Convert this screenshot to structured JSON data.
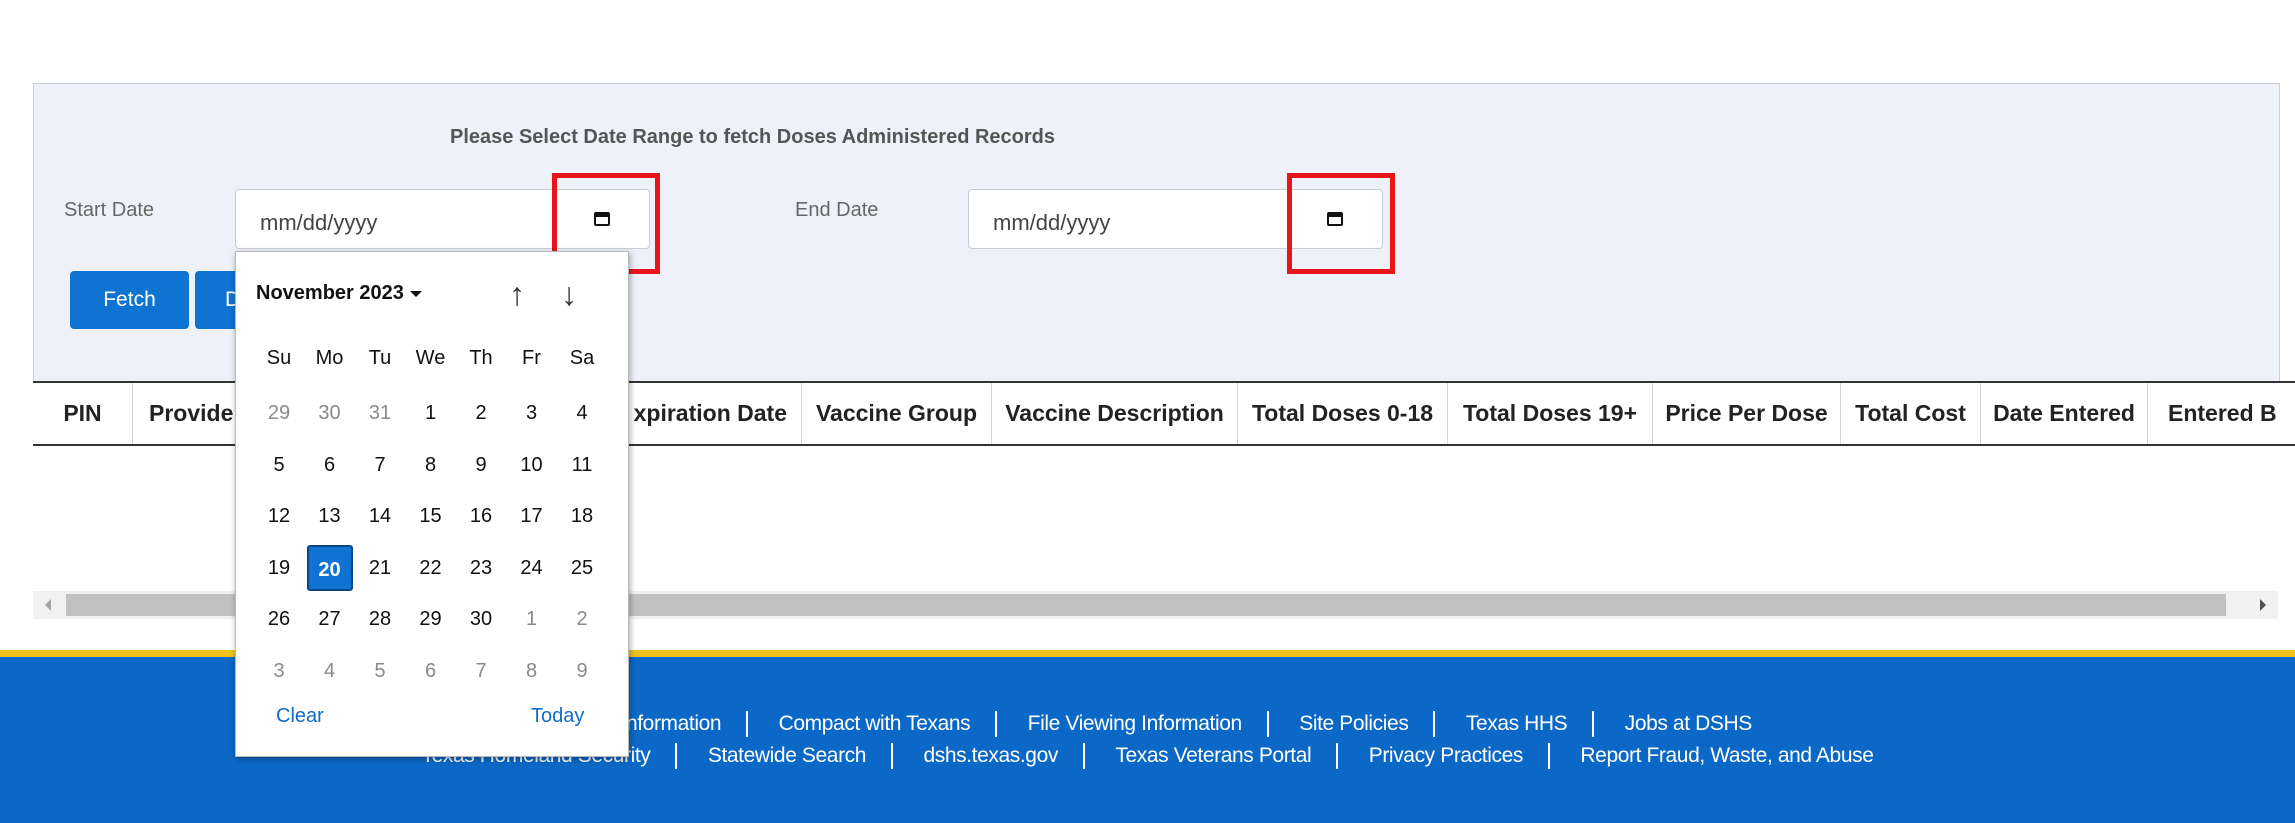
{
  "panel": {
    "heading": "Please Select Date Range to fetch Doses Administered Records",
    "start_label": "Start Date",
    "end_label": "End Date",
    "start_placeholder": "mm/dd/yyyy",
    "end_placeholder": "mm/dd/yyyy",
    "fetch_label": "Fetch",
    "second_button_label": "D"
  },
  "table": {
    "headers": [
      "PIN",
      "Provide",
      "xpiration Date",
      "Vaccine Group",
      "Vaccine Description",
      "Total Doses 0-18",
      "Total Doses 19+",
      "Price Per Dose",
      "Total Cost",
      "Date Entered",
      "Entered B"
    ]
  },
  "datepicker": {
    "month_label": "November 2023",
    "prev_icon": "up-arrow-icon",
    "next_icon": "down-arrow-icon",
    "weekdays": [
      "Su",
      "Mo",
      "Tu",
      "We",
      "Th",
      "Fr",
      "Sa"
    ],
    "weeks": [
      [
        "29",
        "30",
        "31",
        "1",
        "2",
        "3",
        "4"
      ],
      [
        "5",
        "6",
        "7",
        "8",
        "9",
        "10",
        "11"
      ],
      [
        "12",
        "13",
        "14",
        "15",
        "16",
        "17",
        "18"
      ],
      [
        "19",
        "20",
        "21",
        "22",
        "23",
        "24",
        "25"
      ],
      [
        "26",
        "27",
        "28",
        "29",
        "30",
        "1",
        "2"
      ],
      [
        "3",
        "4",
        "5",
        "6",
        "7",
        "8",
        "9"
      ]
    ],
    "selected_day": "20",
    "clear_label": "Clear",
    "today_label": "Today"
  },
  "footer": {
    "row1": [
      "isitor Information",
      "Compact with Texans",
      "File Viewing Information",
      "Site Policies",
      "Texas HHS",
      "Jobs at DSHS"
    ],
    "row2": [
      "Texas Homeland Security",
      "Statewide Search",
      "dshs.texas.gov",
      "Texas Veterans Portal",
      "Privacy Practices",
      "Report Fraud, Waste, and Abuse"
    ]
  },
  "colors": {
    "primary": "#0f74d1",
    "footer_bg": "#0c68c7",
    "footer_border": "#f0c21a",
    "highlight": "#e8141c"
  }
}
